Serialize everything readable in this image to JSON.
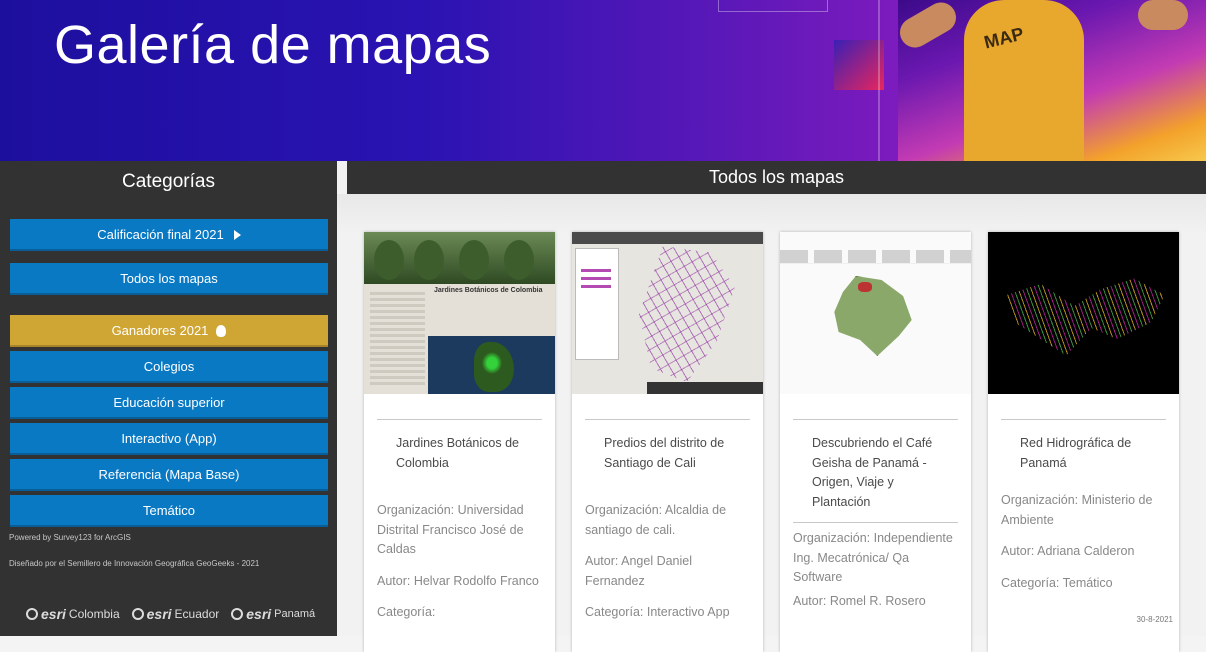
{
  "banner": {
    "title": "Galería de mapas",
    "shirt_text": "MAP"
  },
  "sidebar": {
    "heading": "Categorías",
    "buttons": [
      {
        "label": "Calificación final 2021",
        "icon": "play-triangle-icon"
      },
      {
        "label": "Todos los mapas"
      },
      {
        "label": "Ganadores 2021",
        "icon": "lightbulb-icon",
        "color": "#cfa534"
      },
      {
        "label": "Colegios"
      },
      {
        "label": "Educación superior"
      },
      {
        "label": "Interactivo (App)"
      },
      {
        "label": "Referencia (Mapa Base)"
      },
      {
        "label": "Temático"
      }
    ],
    "powered_by": "Powered by Survey123 for ArcGIS",
    "designed_by": "Diseñado por el Semillero de Innovación Geográfica GeoGeeks - 2021",
    "logos": [
      {
        "brand": "esri",
        "country": "Colombia"
      },
      {
        "brand": "esri",
        "country": "Ecuador"
      },
      {
        "brand": "esri",
        "country": "Panamá"
      }
    ]
  },
  "main": {
    "heading": "Todos los mapas",
    "cards": [
      {
        "title": "Jardines Botánicos de Colombia",
        "thumb_title": "Jardines Botánicos de Colombia",
        "organization": "Organización: Universidad Distrital Francisco José de Caldas",
        "author": "Autor: Helvar Rodolfo Franco",
        "category": "Categoría:"
      },
      {
        "title": "Predios del distrito de Santiago de Cali",
        "organization": "Organización: Alcaldia de santiago de cali.",
        "author": "Autor: Angel Daniel Fernandez",
        "category": "Categoría: Interactivo App"
      },
      {
        "title": "Descubriendo el Café Geisha de Panamá - Origen, Viaje y Plantación",
        "organization": "Organización: Independiente Ing. Mecatrónica/ Qa Software",
        "author": "Autor: Romel R. Rosero"
      },
      {
        "title": "Red Hidrográfica de Panamá",
        "organization": "Organización: Ministerio de Ambiente",
        "author": "Autor: Adriana Calderon",
        "category": "Categoría: Temático",
        "date": "30-8-2021"
      }
    ]
  },
  "colors": {
    "accent": "#0a79c4",
    "gold": "#cfa534",
    "sidebar_bg": "#323232"
  }
}
